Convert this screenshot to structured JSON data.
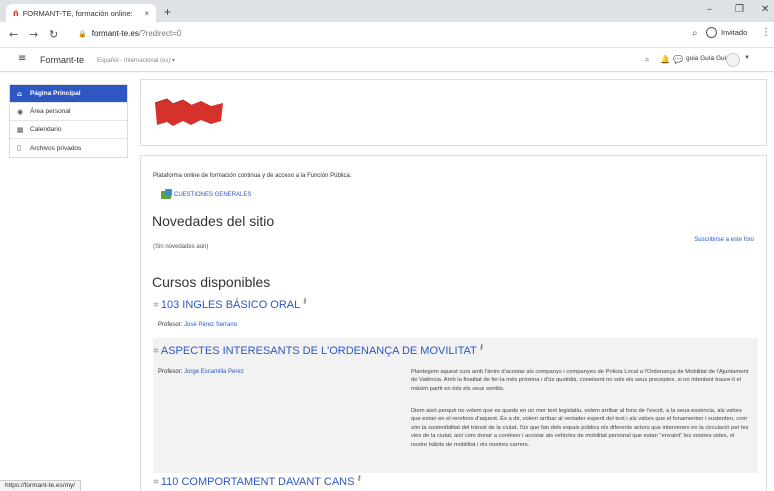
{
  "browser": {
    "tab_title": "FORMANT-TE, formación online: ",
    "tab_close": "×",
    "new_tab": "+",
    "url_host": "formant-te.es",
    "url_path": "/?redirect=0",
    "profile_name": "Invitado",
    "status_url": "https://formant-te.es/my/"
  },
  "navbar": {
    "brand": "Formant-te",
    "language": "Español - Internacional (es)",
    "user_name": "guia Guía Guía"
  },
  "sidebar": {
    "items": [
      {
        "label": "Página Principal",
        "icon": "home-icon"
      },
      {
        "label": "Área personal",
        "icon": "dashboard-icon"
      },
      {
        "label": "Calendario",
        "icon": "calendar-icon"
      },
      {
        "label": "Archivos privados",
        "icon": "file-icon"
      }
    ]
  },
  "main": {
    "intro": "Plataforma online de formación continua y de acceso a la Función Pública.",
    "general_link": "CUESTIONES GENERALES",
    "news_heading": "Novedades del sitio",
    "no_news": "(Sin novedades aún)",
    "subscribe": "Suscribirse a este foro",
    "courses_heading": "Cursos disponibles",
    "teacher_label": "Profesor:",
    "courses": [
      {
        "title": "103 INGLES BÁSICO ORAL",
        "teacher": "José Pérez Serrano"
      },
      {
        "title": "ASPECTES INTERESANTS DE L'ORDENANÇA DE MOVILITAT",
        "teacher": "Jorge Escamilla Perez",
        "summary_1": "Plantegem aquest curs amb l'ànim d'acostar als companys i companyes de Policia Local a l'Ordenança de Mobilitat de l'Ajuntament de València. Amb la finalitat de fer-la més pròxima i d'ús quotidià, coneixent no sols els seus preceptes, si no intentant traure-li el màxim partit en tots els seus sentits.",
        "summary_2": "Diem això perquè no volem que es quede en un mer text legislatiu, volem arribar al fons de l'escrit, a la seua essència, als valors que estan en el rerefons d'aquest. És a dir, volem arribar al vertader esperit del text i als valors que el fonamenten i sustenten, com són la sostenibilitat del trànsit de la ciutat, l'ús que fan dels espais públics els diferents actors que intervenen en la circulació per les vies de la ciutat, així com donar a conèixer i acostar als vehicles de mobilitat personal que estan \"envaint\" les vostres vides, el nostre hàbits de mobilitat i els nostres carrers."
      },
      {
        "title": "110 COMPORTAMENT DAVANT CANS"
      }
    ]
  }
}
